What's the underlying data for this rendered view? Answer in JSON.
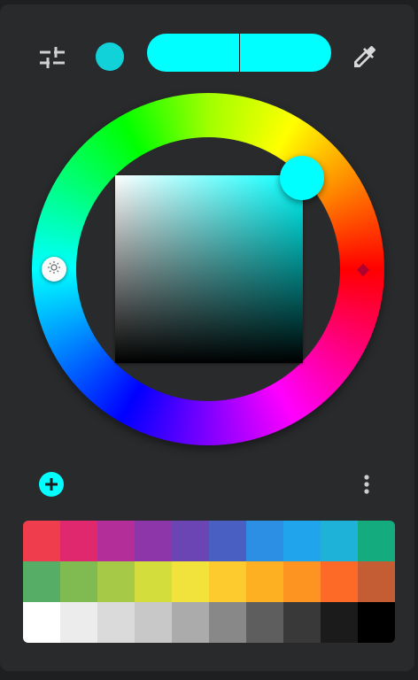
{
  "app": {
    "selected_color": "#00ffff",
    "previous_color": "#00ffff",
    "accent_color": "#00ffff",
    "panel_color": "#292a2c",
    "dot_swatch_color": "#11d2d9"
  },
  "toolbar": {
    "settings_icon": "tune-sliders-icon",
    "eyedropper_icon": "eyedropper-icon"
  },
  "wheel": {
    "hue_degrees": 180,
    "saturation_percent": 100,
    "value_percent": 100,
    "brightness_handle_icon": "sun-icon"
  },
  "actions": {
    "add_icon": "plus-circle-icon",
    "more_icon": "more-vertical-icon"
  },
  "palette": {
    "rows": [
      [
        "#ef3d4e",
        "#e0286e",
        "#b42e9a",
        "#8d36a9",
        "#6c45b4",
        "#4a5fc2",
        "#2d8fe4",
        "#20a4eb",
        "#1eb2d9",
        "#14ac7e"
      ],
      [
        "#56ad66",
        "#80bb52",
        "#a6ca47",
        "#d3dd3b",
        "#f2e33c",
        "#fdcb2e",
        "#fdb021",
        "#fd9421",
        "#fd6a27",
        "#c45d33"
      ],
      [
        "#ffffff",
        "#ececec",
        "#dadada",
        "#c8c8c8",
        "#ababab",
        "#888888",
        "#5e5e5e",
        "#393939",
        "#1b1b1b",
        "#000000"
      ]
    ]
  }
}
